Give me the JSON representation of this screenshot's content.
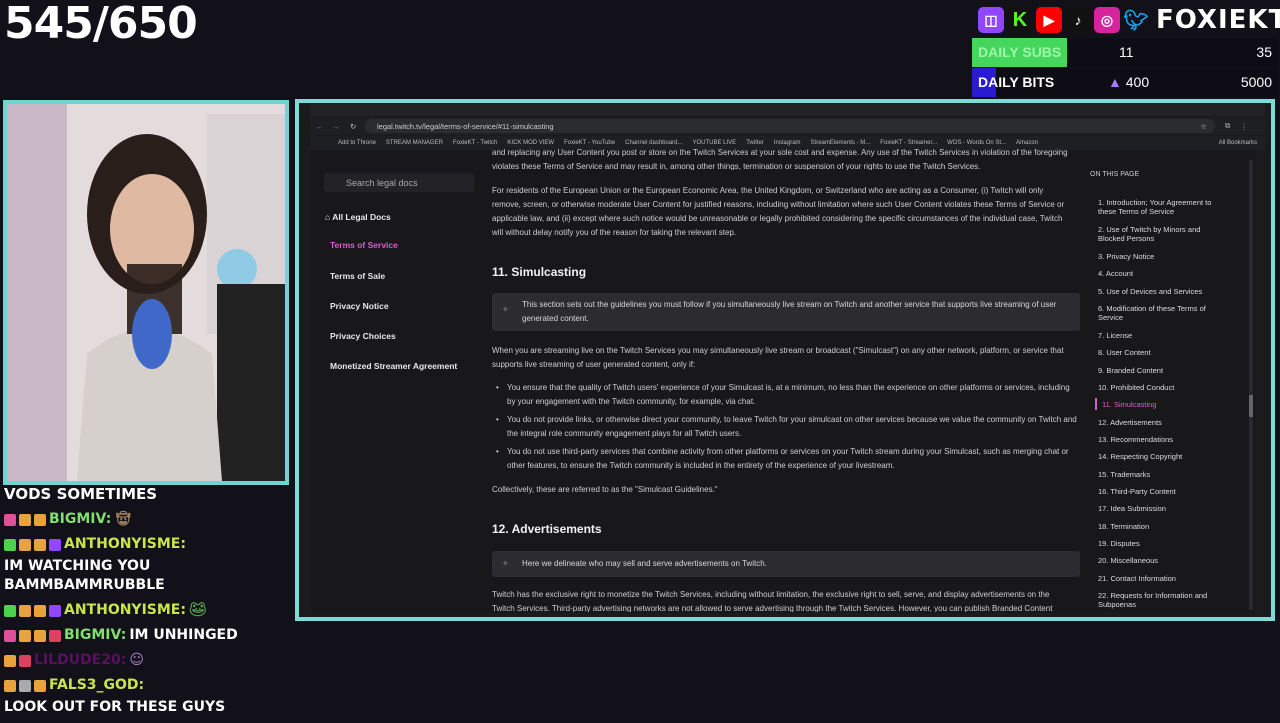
{
  "overlay": {
    "counter": "545/650",
    "handle": "FOXIEKT",
    "social_icons": [
      "twitch-icon",
      "kick-icon",
      "youtube-icon",
      "tiktok-icon",
      "instagram-icon",
      "twitter-icon"
    ],
    "daily_subs": {
      "label": "DAILY SUBS",
      "current": "11",
      "max": "35",
      "progress": 0.31
    },
    "daily_bits": {
      "label": "DAILY BITS",
      "current": "400",
      "max": "5000",
      "progress": 0.08
    }
  },
  "chat": {
    "header": "VODS SOMETIMES",
    "messages": [
      {
        "user": "BIGMIV:",
        "text": "",
        "color": "#7fe06e"
      },
      {
        "user": "ANTHONYISME:",
        "text": "IM WATCHING YOU BAMMBAMMRUBBLE",
        "color": "#c7e64e"
      },
      {
        "user": "ANTHONYISME:",
        "text": "",
        "color": "#c7e64e"
      },
      {
        "user": "BIGMIV:",
        "text": "IM UNHINGED",
        "color": "#7fe06e"
      },
      {
        "user": "LILDUDE20:",
        "text": "",
        "color": "#5a1060"
      },
      {
        "user": "FALS3_GOD:",
        "text": "LOOK OUT FOR THESE GUYS",
        "color": "#c7e64e"
      }
    ]
  },
  "browser": {
    "url": "legal.twitch.tv/legal/terms-of-service/#11-simulcasting",
    "bookmarks": [
      "Add to Throne",
      "STREAM MANAGER",
      "FoxieKT - Twitch",
      "KICK MOD VIEW",
      "FoxieKT - YouTube",
      "Channel dashboard...",
      "YOUTUBE LIVE",
      "Twitter",
      "Instagram",
      "StreamElements - M...",
      "FoxieKT - Streamer...",
      "WOS - Words On St...",
      "Amazon"
    ],
    "all_bookmarks": "All Bookmarks"
  },
  "sidebar": {
    "search_placeholder": "Search legal docs",
    "all_docs": "All Legal Docs",
    "items": [
      "Terms of Service",
      "Terms of Sale",
      "Privacy Notice",
      "Privacy Choices",
      "Monetized Streamer Agreement"
    ]
  },
  "content": {
    "p0": "and replacing any User Content you post or store on the Twitch Services at your sole cost and expense. Any use of the Twitch Services in violation of the foregoing violates these Terms of Service and may result in, among other things, termination or suspension of your rights to use the Twitch Services.",
    "p1": "For residents of the European Union or the European Economic Area, the United Kingdom, or Switzerland who are acting as a Consumer, (i) Twitch will only remove, screen, or otherwise moderate User Content for justified reasons, including without limitation where such User Content violates these Terms of Service or applicable law, and (ii) except where such notice would be unreasonable or legally prohibited considering the specific circumstances of the individual case, Twitch will without delay notify you of the reason for taking the relevant step.",
    "h11": "11. Simulcasting",
    "callout11": "This section sets out the guidelines you must follow if you simultaneously live stream on Twitch and another service that supports live streaming of user generated content.",
    "p2": "When you are streaming live on the Twitch Services you may simultaneously live stream or broadcast (\"Simulcast\") on any other network, platform, or service that supports live streaming of user generated content, only if:",
    "b1": "You ensure that the quality of Twitch users' experience of your Simulcast is, at a minimum, no less than the experience on other platforms or services, including by your engagement with the Twitch community, for example, via chat.",
    "b2": "You do not provide links, or otherwise direct your community, to leave Twitch for your simulcast on other services because we value the community on Twitch and the integral role community engagement plays for all Twitch users.",
    "b3": "You do not use third-party services that combine activity from other platforms or services on your Twitch stream during your Simulcast, such as merging chat or other features, to ensure the Twitch community is included in the entirety of the experience of your livestream.",
    "p3": "Collectively, these are referred to as the \"Simulcast Guidelines.\"",
    "h12": "12. Advertisements",
    "callout12": "Here we delineate who may sell and serve advertisements on Twitch.",
    "p4": "Twitch has the exclusive right to monetize the Twitch Services, including without limitation, the exclusive right to sell, serve, and display advertisements on the Twitch Services. Third-party advertising networks are not allowed to serve advertising through the Twitch Services. However, you can publish Branded Content using the"
  },
  "toc": {
    "title": "ON THIS PAGE",
    "items": [
      "1. Introduction; Your Agreement to these Terms of Service",
      "2. Use of Twitch by Minors and Blocked Persons",
      "3. Privacy Notice",
      "4. Account",
      "5. Use of Devices and Services",
      "6. Modification of these Terms of Service",
      "7. License",
      "8. User Content",
      "9. Branded Content",
      "10. Prohibited Conduct",
      "11. Simulcasting",
      "12. Advertisements",
      "13. Recommendations",
      "14. Respecting Copyright",
      "15. Trademarks",
      "16. Third-Party Content",
      "17. Idea Submission",
      "18. Termination",
      "19. Disputes",
      "20. Miscellaneous",
      "21. Contact Information",
      "22. Requests for Information and Subpoenas"
    ],
    "active": "11. Simulcasting"
  },
  "colors": {
    "accent": "#bf94ff",
    "twitch_purple": "#9146ff",
    "frame": "#7ddbd8",
    "subs_fill": "#45d65e",
    "bits_fill": "#2a1bd1"
  }
}
